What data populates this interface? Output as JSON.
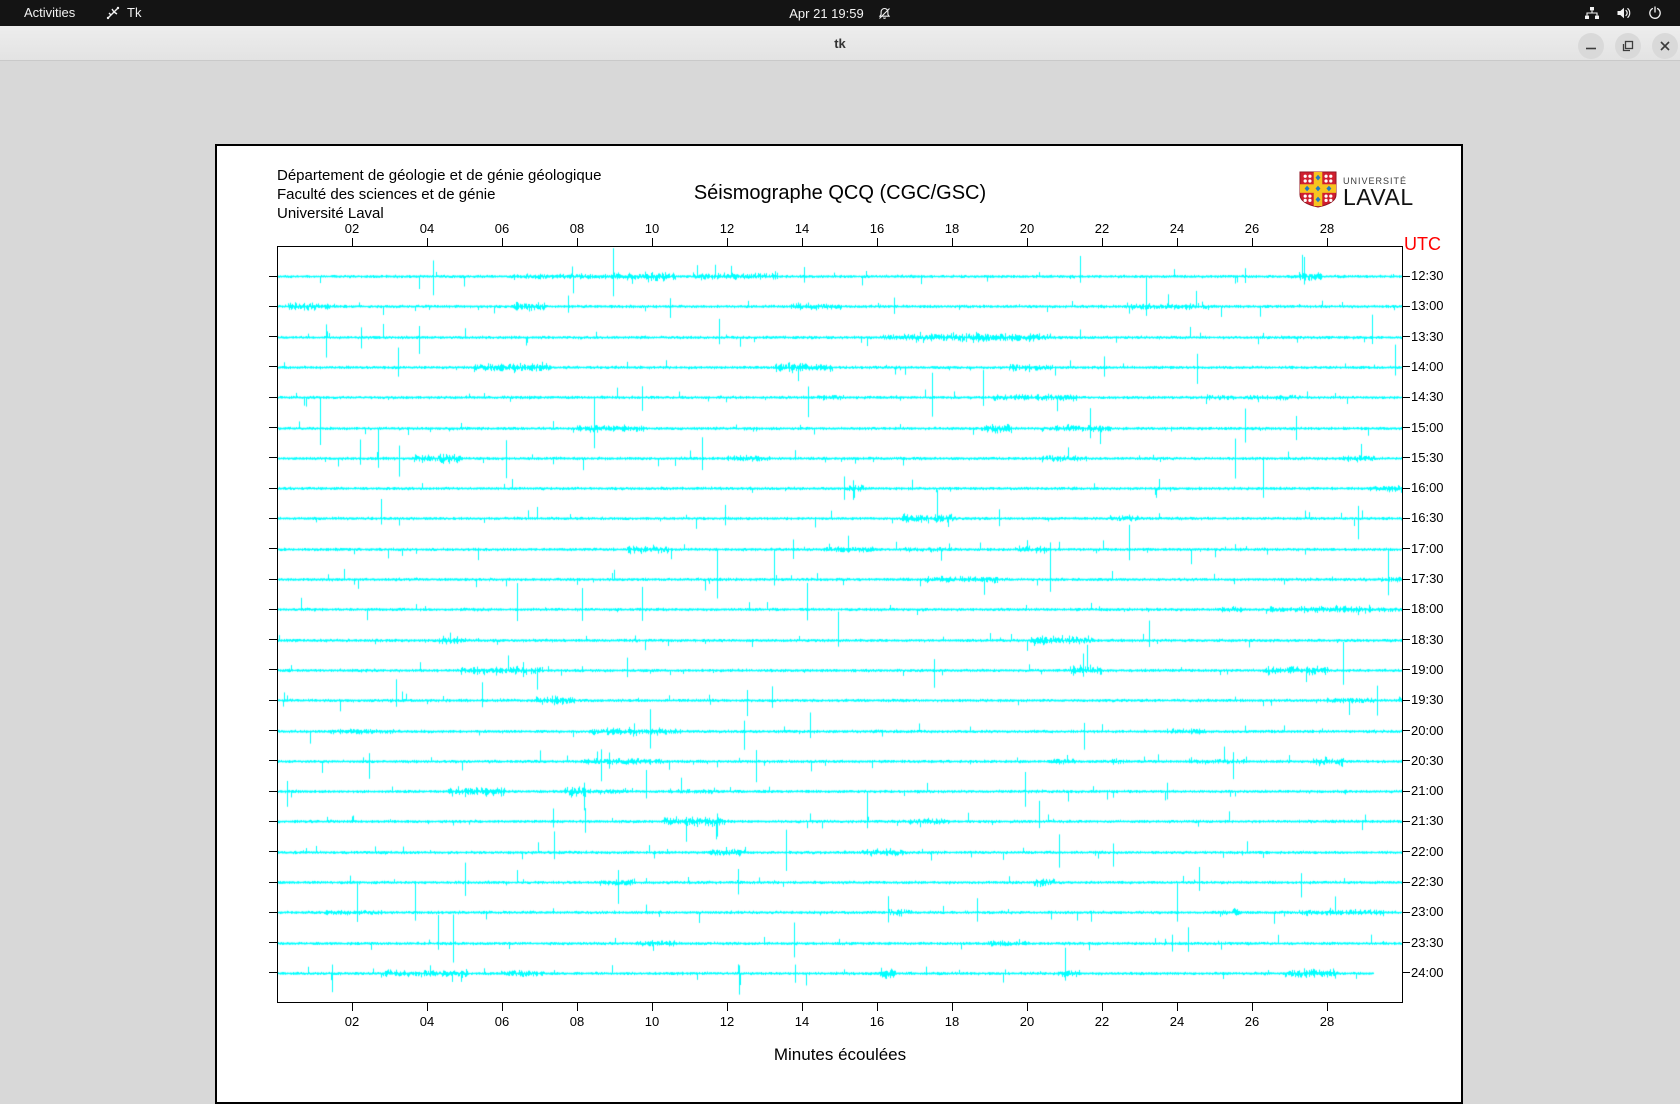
{
  "topbar": {
    "activities_label": "Activities",
    "app_name": "Tk",
    "clock": "Apr 21 19:59"
  },
  "titlebar": {
    "title": "tk"
  },
  "header": {
    "lines": [
      "Département de géologie et de génie géologique",
      "Faculté des sciences et de génie",
      "Université Laval"
    ]
  },
  "logo": {
    "small": "UNIVERSITÉ",
    "large": "LAVAL"
  },
  "chart_data": {
    "type": "line",
    "title": "Séismographe QCQ (CGC/GSC)",
    "xlabel": "Minutes écoulées",
    "x_range": [
      0,
      30
    ],
    "x_tick_minutes": [
      2,
      4,
      6,
      8,
      10,
      12,
      14,
      16,
      18,
      20,
      22,
      24,
      26,
      28
    ],
    "x_tick_labels": [
      "02",
      "04",
      "06",
      "08",
      "10",
      "12",
      "14",
      "16",
      "18",
      "20",
      "22",
      "24",
      "26",
      "28"
    ],
    "y_axis_title": "UTC",
    "y_axis_title_color": "#ff0000",
    "trace_color": "#00ffff",
    "grid": false,
    "rows": [
      {
        "label": "12:30",
        "minutes": 30
      },
      {
        "label": "13:00",
        "minutes": 30
      },
      {
        "label": "13:30",
        "minutes": 30
      },
      {
        "label": "14:00",
        "minutes": 30
      },
      {
        "label": "14:30",
        "minutes": 30
      },
      {
        "label": "15:00",
        "minutes": 30
      },
      {
        "label": "15:30",
        "minutes": 30
      },
      {
        "label": "16:00",
        "minutes": 30
      },
      {
        "label": "16:30",
        "minutes": 30
      },
      {
        "label": "17:00",
        "minutes": 30
      },
      {
        "label": "17:30",
        "minutes": 30
      },
      {
        "label": "18:00",
        "minutes": 30
      },
      {
        "label": "18:30",
        "minutes": 30
      },
      {
        "label": "19:00",
        "minutes": 30
      },
      {
        "label": "19:30",
        "minutes": 30
      },
      {
        "label": "20:00",
        "minutes": 30
      },
      {
        "label": "20:30",
        "minutes": 30
      },
      {
        "label": "21:00",
        "minutes": 30
      },
      {
        "label": "21:30",
        "minutes": 30
      },
      {
        "label": "22:00",
        "minutes": 30
      },
      {
        "label": "22:30",
        "minutes": 30
      },
      {
        "label": "23:00",
        "minutes": 30
      },
      {
        "label": "23:30",
        "minutes": 30
      },
      {
        "label": "24:00",
        "minutes": 29.2
      }
    ],
    "noise_seed": 1371
  }
}
